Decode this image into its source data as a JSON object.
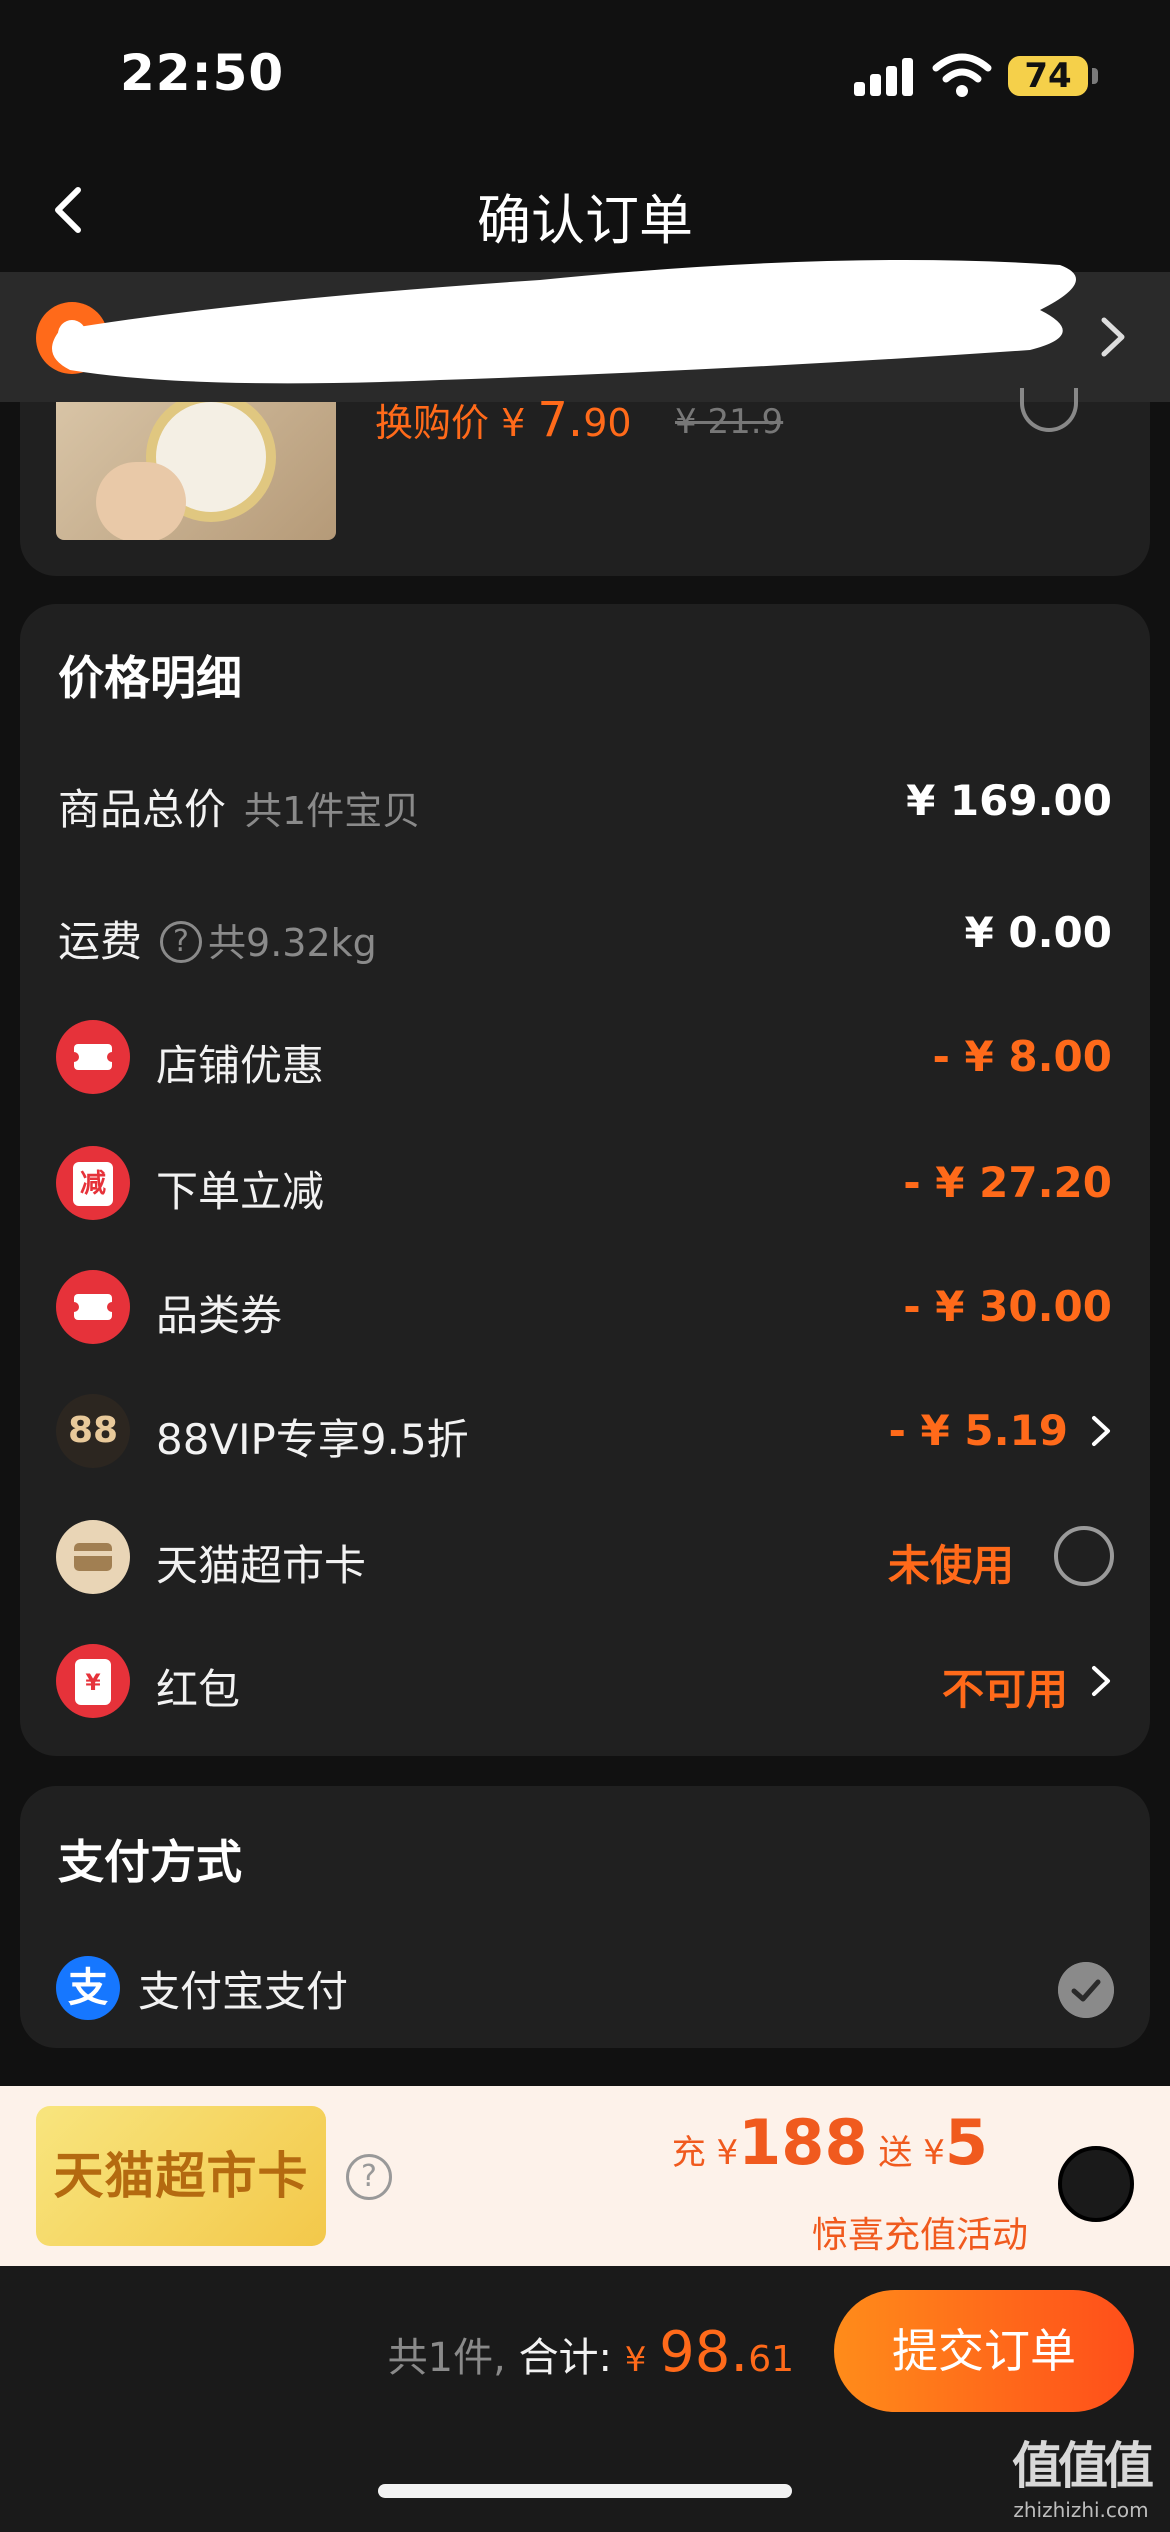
{
  "status_bar": {
    "time": "22:50",
    "battery": "74"
  },
  "nav": {
    "title": "确认订单"
  },
  "product": {
    "swap_label": "换购价",
    "currency": "¥",
    "price_int": "7.",
    "price_dec": "90",
    "original_price": "¥ 21.9"
  },
  "price_detail": {
    "title": "价格明细",
    "rows": [
      {
        "label": "商品总价",
        "sub": "共1件宝贝",
        "value": "¥ 169.00"
      },
      {
        "label": "运费",
        "sub": "共9.32kg",
        "value": "¥ 0.00"
      },
      {
        "label": "店铺优惠",
        "value": "- ¥ 8.00"
      },
      {
        "label": "下单立减",
        "value": "- ¥ 27.20",
        "icon_text": "减"
      },
      {
        "label": "品类券",
        "value": "- ¥ 30.00"
      },
      {
        "label": "88VIP专享9.5折",
        "value": "- ¥ 5.19",
        "icon_text": "88"
      },
      {
        "label": "天猫超市卡",
        "value": "未使用"
      },
      {
        "label": "红包",
        "value": "不可用",
        "icon_text": "¥"
      }
    ]
  },
  "payment": {
    "title": "支付方式",
    "method_label": "支付宝支付",
    "method_icon_text": "支"
  },
  "promo": {
    "card_text": "天猫超市卡",
    "recharge_prefix": "充",
    "currency": "¥",
    "recharge_amount": "188",
    "gift_prefix": "送",
    "gift_amount": "5",
    "activity": "惊喜充值活动"
  },
  "bottom": {
    "count_text": "共1件,",
    "total_label": "合计:",
    "currency": "¥",
    "total_int": "98.",
    "total_dec": "61",
    "submit_label": "提交订单"
  },
  "watermark": {
    "main": "值值值",
    "sub": "zhizhizhi.com"
  },
  "colors": {
    "accent": "#ff6a1a",
    "background": "#111111",
    "card": "#202020"
  }
}
